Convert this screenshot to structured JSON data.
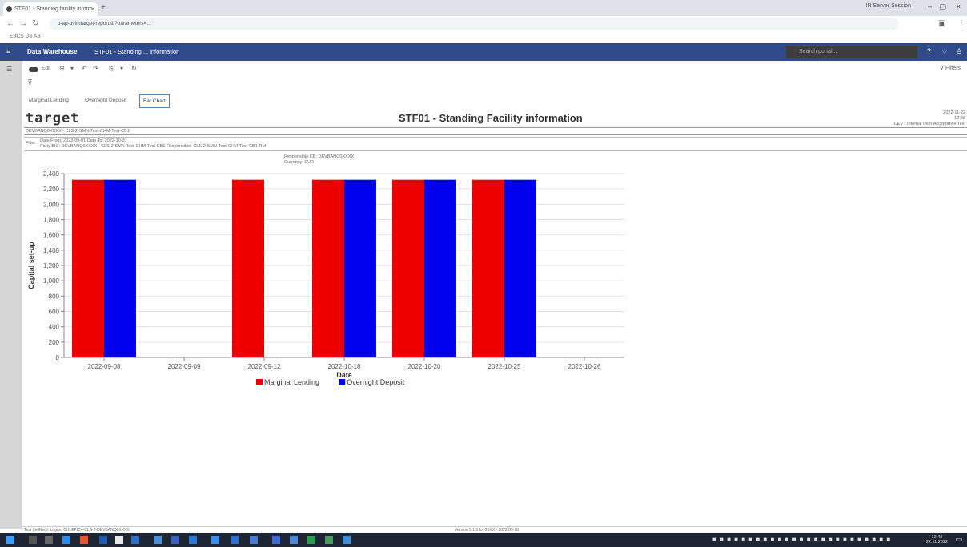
{
  "browser": {
    "tab_title": "STF01 - Standing facility inform...",
    "profile_label": "IR Server Session",
    "url": "tl-ap-dvlmtarget-report.tl/?parameters=...",
    "bookmark": "EBCS DS AB"
  },
  "app": {
    "name": "Data Warehouse",
    "breadcrumb": "STF01 - Standing ... information",
    "search_placeholder": "Search portal..."
  },
  "toolbar": {
    "edit_label": "Edit",
    "filters_label": "Filters"
  },
  "report_tabs": [
    {
      "label": "Marginal Lending"
    },
    {
      "label": "Overnight Deposit"
    },
    {
      "label": "Bar Chart"
    }
  ],
  "report": {
    "logo": "target",
    "title": "STF01 - Standing Facility information",
    "meta_date": "2022-11-22",
    "meta_time": "12:48",
    "meta_system": "DEV - Internal User Acceptance Test",
    "subheader": "DEVBANQ0XXXX - CLS-2-SMN-Test-CHM-Test-CB1",
    "filter_label": "Filter",
    "filter_line1": "Date From: 2022-09-01   Date To: 2022-10-31",
    "filter_line2": "Party BIC: DEVBANQ0XXXX - CLS-2-SMN-Test-CHM-Test-CB1  Responsible: CLS-2-SMN-Test-CHM-Test-CB1-RM",
    "param_responsible": "Responsible CB: DEVBANQ0XXXX",
    "param_currency": "Currency: EUR"
  },
  "chart_data": {
    "type": "bar",
    "title": "",
    "xlabel": "Date",
    "ylabel": "Capital set-up",
    "ylim": [
      0,
      2400
    ],
    "yticks": [
      0,
      200,
      400,
      600,
      800,
      1000,
      1200,
      1400,
      1600,
      1800,
      2000,
      2200,
      2400
    ],
    "categories": [
      "2022-09-08",
      "2022-09-09",
      "2022-09-12",
      "2022-10-18",
      "2022-10-20",
      "2022-10-25",
      "2022-10-26"
    ],
    "series": [
      {
        "name": "Marginal Lending",
        "color": "#ee0000",
        "values": [
          2320,
          0,
          2320,
          2320,
          2320,
          2320,
          0
        ]
      },
      {
        "name": "Overnight Deposit",
        "color": "#0000ee",
        "values": [
          2320,
          0,
          0,
          2320,
          2320,
          2320,
          0
        ]
      }
    ],
    "grid": true,
    "legend": "bottom"
  },
  "statusbar": {
    "left": "Test (InfiNet)t: Logon: CHLEPIC4-CLS-2-DEVBANQ0XXXX",
    "center": "Version 5.1.5 for 20XX - 2022-09-18"
  },
  "taskbar": {
    "time": "12:48",
    "date": "22.11.2022"
  }
}
